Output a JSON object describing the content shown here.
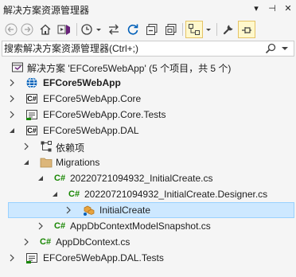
{
  "window": {
    "title": "解决方案资源管理器",
    "buttons": [
      "▾",
      "⊣",
      "✕"
    ]
  },
  "search": {
    "placeholder": "搜索解决方案资源管理器(Ctrl+;)",
    "value": ""
  },
  "colors": {
    "accent": "#005fb8",
    "selection_bg": "#cde8ff",
    "selection_border": "#99d1ff",
    "csharp_green": "#178600",
    "folder": "#dcb67a"
  },
  "tree": {
    "solution_label": "解决方案 'EFCore5WebApp' (5 个项目，共 5 个)",
    "items": [
      {
        "label": "EFCore5WebApp",
        "icon": "web-project-icon"
      },
      {
        "label": "EFCore5WebApp.Core",
        "icon": "csharp-project-icon"
      },
      {
        "label": "EFCore5WebApp.Core.Tests",
        "icon": "test-project-icon"
      },
      {
        "label": "EFCore5WebApp.DAL",
        "icon": "csharp-project-icon"
      },
      {
        "label": "依赖项",
        "icon": "dependencies-icon"
      },
      {
        "label": "Migrations",
        "icon": "folder-icon"
      },
      {
        "label": "20220721094932_InitialCreate.cs",
        "icon": "csharp-file-icon"
      },
      {
        "label": "20220721094932_InitialCreate.Designer.cs",
        "icon": "csharp-file-icon"
      },
      {
        "label": "InitialCreate",
        "icon": "class-icon"
      },
      {
        "label": "AppDbContextModelSnapshot.cs",
        "icon": "csharp-file-icon"
      },
      {
        "label": "AppDbContext.cs",
        "icon": "csharp-file-icon"
      },
      {
        "label": "EFCore5WebApp.DAL.Tests",
        "icon": "test-project-icon"
      }
    ],
    "cs_tag": "C#"
  }
}
